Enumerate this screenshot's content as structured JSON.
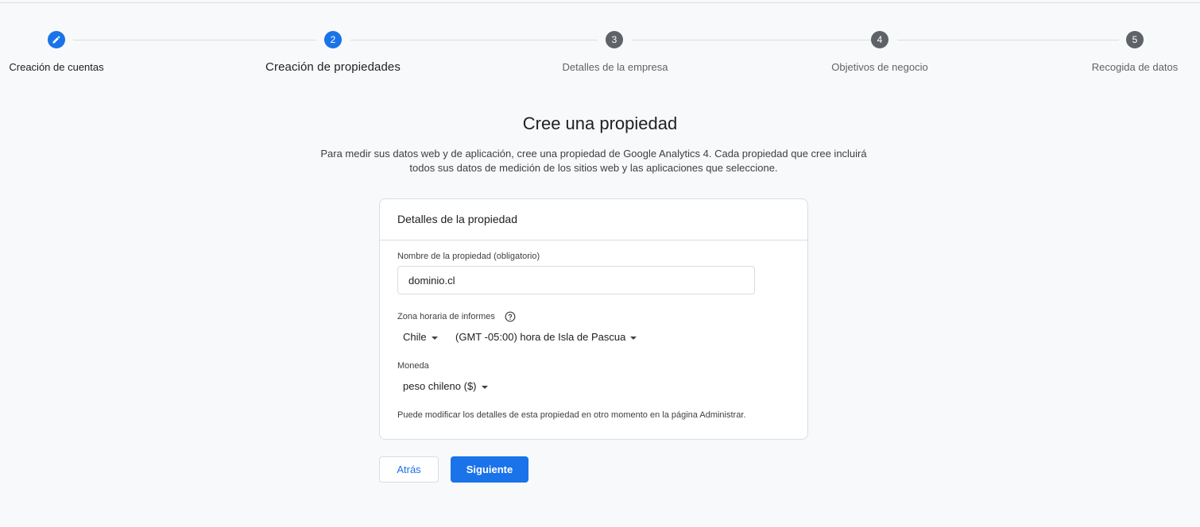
{
  "stepper": {
    "steps": [
      {
        "number": "",
        "label": "Creación de cuentas",
        "state": "done"
      },
      {
        "number": "2",
        "label": "Creación de propiedades",
        "state": "active"
      },
      {
        "number": "3",
        "label": "Detalles de la empresa",
        "state": "pending"
      },
      {
        "number": "4",
        "label": "Objetivos de negocio",
        "state": "pending"
      },
      {
        "number": "5",
        "label": "Recogida de datos",
        "state": "pending"
      }
    ],
    "done_icon": "pencil-icon"
  },
  "main": {
    "title": "Cree una propiedad",
    "subtitle_line1": "Para medir sus datos web y de aplicación, cree una propiedad de Google Analytics 4. Cada propiedad que cree incluirá",
    "subtitle_line2": "todos sus datos de medición de los sitios web y las aplicaciones que seleccione."
  },
  "card": {
    "header": "Detalles de la propiedad",
    "property_name_label": "Nombre de la propiedad (obligatorio)",
    "property_name_value": "dominio.cl",
    "timezone_label": "Zona horaria de informes",
    "timezone_help_icon": "help-circle-icon",
    "country_value": "Chile",
    "timezone_value": "(GMT -05:00) hora de Isla de Pascua",
    "currency_label": "Moneda",
    "currency_value": "peso chileno ($)",
    "hint": "Puede modificar los detalles de esta propiedad en otro momento en la página Administrar."
  },
  "actions": {
    "back_label": "Atrás",
    "next_label": "Siguiente"
  },
  "colors": {
    "accent": "#1a73e8",
    "pending": "#5f6368",
    "border": "#dadce0",
    "background": "#f8f9fa"
  }
}
